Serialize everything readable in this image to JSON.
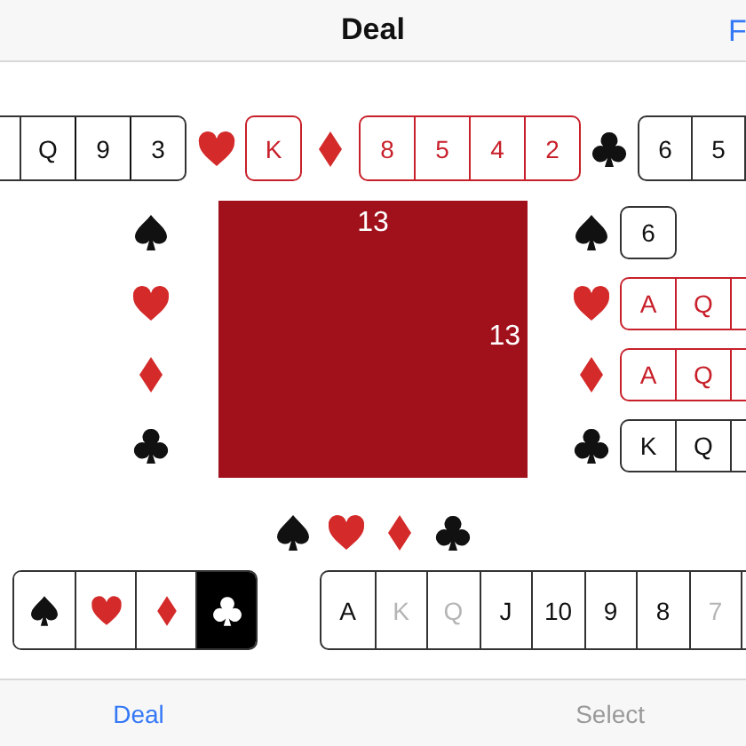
{
  "nav": {
    "title": "Deal",
    "right_button": "F"
  },
  "north": [
    {
      "kind": "spades",
      "cards": [
        "Q",
        "9",
        "3"
      ],
      "cut_left": true,
      "cut_right": false
    },
    {
      "kind": "hearts",
      "cards": [
        "K"
      ],
      "cut_right": false
    },
    {
      "kind": "diamonds",
      "cards": [
        "8",
        "5",
        "4",
        "2"
      ],
      "cut_right": false
    },
    {
      "kind": "clubs",
      "cards": [
        "6",
        "5"
      ],
      "cut_right": true
    }
  ],
  "west": [
    {
      "kind": "spades"
    },
    {
      "kind": "hearts"
    },
    {
      "kind": "diamonds"
    },
    {
      "kind": "clubs"
    }
  ],
  "table": {
    "north_count": "13",
    "east_count": "13"
  },
  "east": [
    {
      "kind": "spades",
      "cards": [
        "6"
      ],
      "cut_right": false
    },
    {
      "kind": "hearts",
      "cards": [
        "A",
        "Q"
      ],
      "cut_right": true
    },
    {
      "kind": "diamonds",
      "cards": [
        "A",
        "Q"
      ],
      "cut_right": true
    },
    {
      "kind": "clubs",
      "cards": [
        "K",
        "Q"
      ],
      "cut_right": true
    }
  ],
  "south": [
    {
      "kind": "spades"
    },
    {
      "kind": "hearts"
    },
    {
      "kind": "diamonds"
    },
    {
      "kind": "clubs"
    }
  ],
  "suit_picker": [
    {
      "kind": "spades",
      "selected": false
    },
    {
      "kind": "hearts",
      "selected": false
    },
    {
      "kind": "diamonds",
      "selected": false
    },
    {
      "kind": "clubs",
      "selected": true
    }
  ],
  "rank_picker": {
    "cut_right": true,
    "ranks": [
      {
        "rank": "A",
        "disabled": false
      },
      {
        "rank": "K",
        "disabled": true
      },
      {
        "rank": "Q",
        "disabled": true
      },
      {
        "rank": "J",
        "disabled": false
      },
      {
        "rank": "10",
        "disabled": false
      },
      {
        "rank": "9",
        "disabled": false
      },
      {
        "rank": "8",
        "disabled": false
      },
      {
        "rank": "7",
        "disabled": true
      }
    ]
  },
  "tabs": [
    {
      "label": "Deal",
      "selected": true
    },
    {
      "label": "Select",
      "selected": false
    }
  ]
}
